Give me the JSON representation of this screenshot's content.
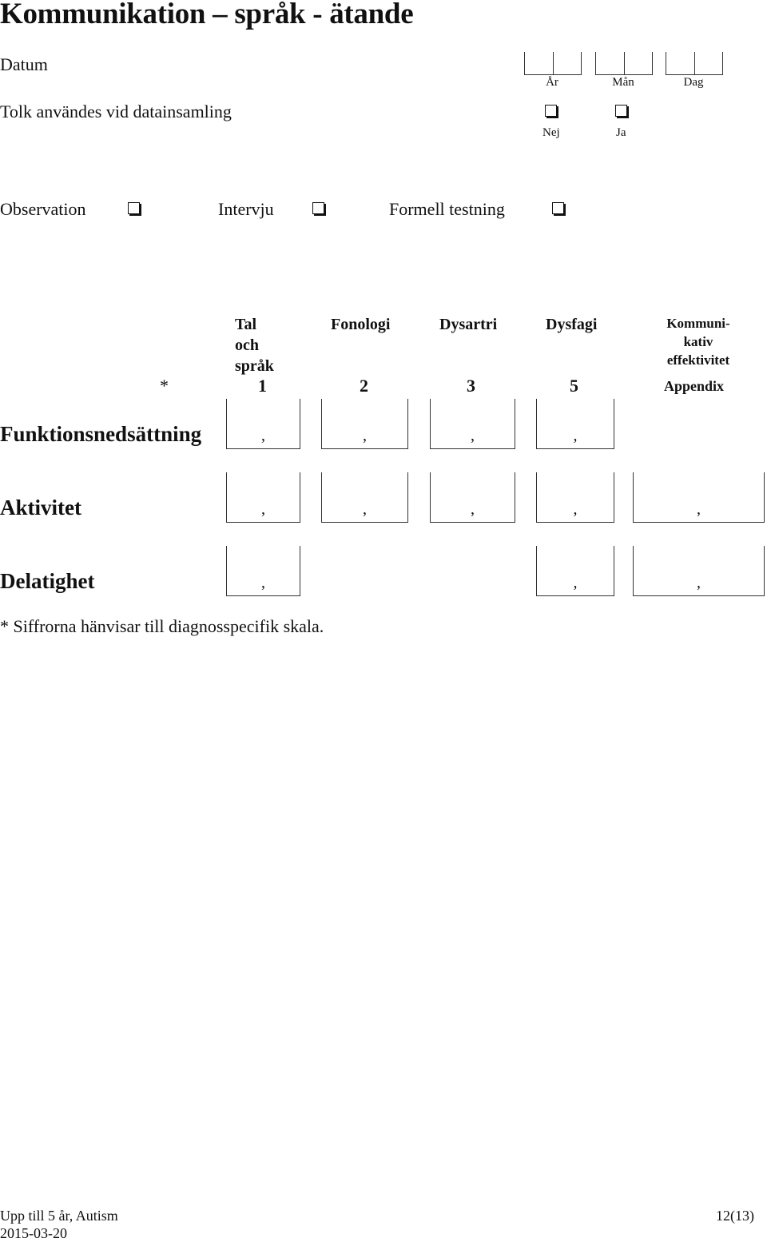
{
  "title": "Kommunikation – språk - ätande",
  "date": {
    "label": "Datum",
    "fields": [
      "År",
      "Mån",
      "Dag"
    ]
  },
  "interpreter": {
    "label": "Tolk användes vid datainsamling",
    "options": [
      "Nej",
      "Ja"
    ]
  },
  "methods": [
    "Observation",
    "Intervju",
    "Formell testning"
  ],
  "columns": [
    {
      "header": [
        "Tal",
        "och",
        "språk"
      ],
      "number": "1"
    },
    {
      "header": [
        "Fonologi"
      ],
      "number": "2"
    },
    {
      "header": [
        "Dysartri"
      ],
      "number": "3"
    },
    {
      "header": [
        "Dysfagi"
      ],
      "number": "5"
    },
    {
      "header": [
        "Kommuni-",
        "kativ",
        "effektivitet"
      ],
      "number": "Appendix"
    }
  ],
  "asterisk": "*",
  "rows": [
    {
      "label": "Funktionsnedsättning",
      "separator": ","
    },
    {
      "label": "Aktivitet",
      "separator": ","
    },
    {
      "label": "Delatighet",
      "separator": ","
    }
  ],
  "footnote": "* Siffrorna hänvisar till diagnosspecifik skala.",
  "footer": {
    "doc": "Upp till 5 år, Autism",
    "date": "2015-03-20",
    "page": "12(13)"
  }
}
